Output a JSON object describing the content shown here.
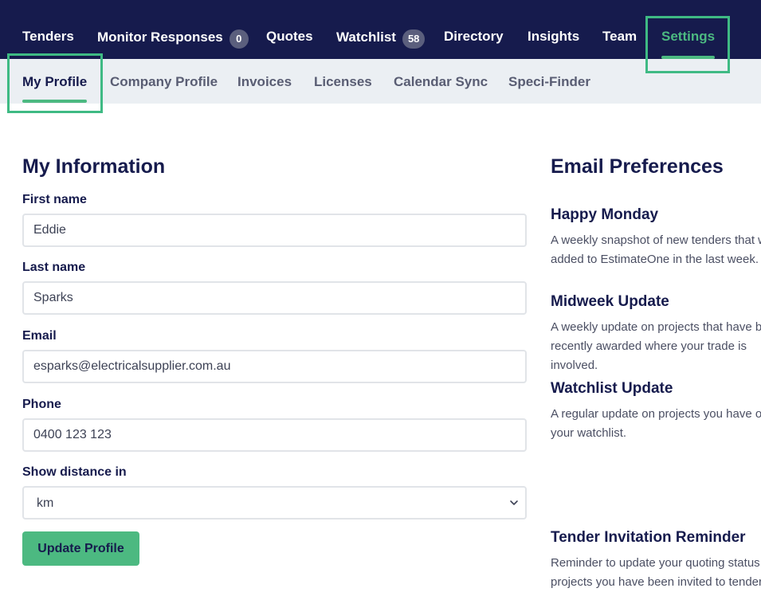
{
  "topnav": {
    "items": [
      {
        "label": "Tenders"
      },
      {
        "label": "Monitor Responses",
        "badge": "0"
      },
      {
        "label": "Quotes"
      },
      {
        "label": "Watchlist",
        "badge": "58"
      },
      {
        "label": "Directory"
      },
      {
        "label": "Insights"
      },
      {
        "label": "Team"
      },
      {
        "label": "Settings",
        "active": true
      }
    ]
  },
  "subnav": {
    "items": [
      {
        "label": "My Profile",
        "active": true
      },
      {
        "label": "Company Profile"
      },
      {
        "label": "Invoices"
      },
      {
        "label": "Licenses"
      },
      {
        "label": "Calendar Sync"
      },
      {
        "label": "Speci-Finder"
      }
    ]
  },
  "my_information": {
    "title": "My Information",
    "first_name": {
      "label": "First name",
      "value": "Eddie"
    },
    "last_name": {
      "label": "Last name",
      "value": "Sparks"
    },
    "email": {
      "label": "Email",
      "value": "esparks@electricalsupplier.com.au"
    },
    "phone": {
      "label": "Phone",
      "value": "0400 123 123"
    },
    "distance": {
      "label": "Show distance in",
      "value": "km"
    },
    "update_button": "Update Profile"
  },
  "email_preferences": {
    "title": "Email Preferences",
    "items": [
      {
        "title": "Happy Monday",
        "desc": "A weekly snapshot of new tenders that were added to EstimateOne in the last week."
      },
      {
        "title": "Midweek Update",
        "desc": "A weekly update on projects that have been recently awarded where your trade is involved."
      },
      {
        "title": "Watchlist Update",
        "desc": "A regular update on projects you have on your watchlist."
      },
      {
        "title": "Tender Invitation Reminder",
        "desc": "Reminder to update your quoting status on projects you have been invited to tender on."
      }
    ]
  },
  "colors": {
    "nav_bg": "#161b4d",
    "accent": "#4cb981",
    "subnav_bg": "#ebeff3",
    "highlight": "#3fba84"
  }
}
